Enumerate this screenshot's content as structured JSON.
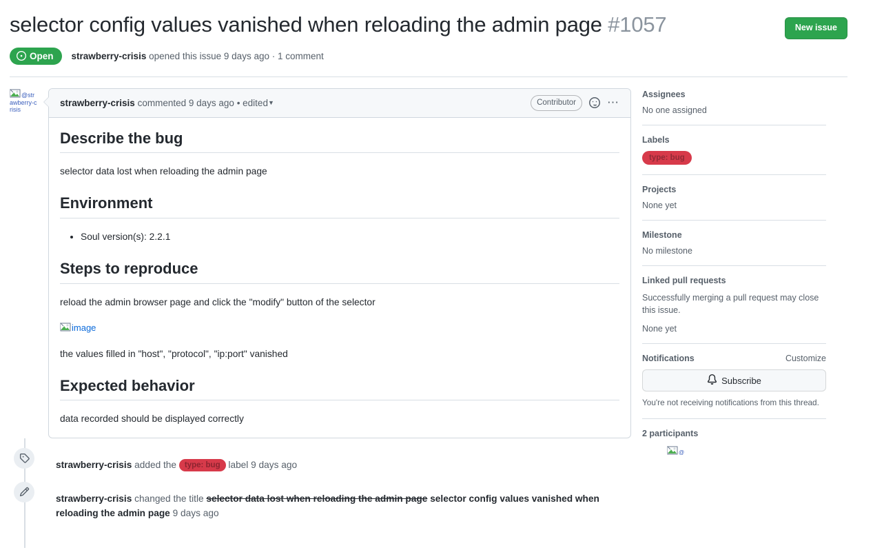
{
  "header": {
    "title": "selector config values vanished when reloading the admin page",
    "issue_number": "#1057",
    "new_issue_label": "New issue",
    "state": "Open",
    "meta_author": "strawberry-crisis",
    "meta_action": "opened this issue 9 days ago",
    "meta_separator": " · ",
    "meta_comments": "1 comment"
  },
  "comment": {
    "avatar_alt": "@strawberry-crisis",
    "author": "strawberry-crisis",
    "commented_text": "commented 9 days ago",
    "edited_text": "• edited",
    "author_badge": "Contributor",
    "reaction_icon": "smiley-icon",
    "menu_icon": "kebab-icon",
    "sections": [
      {
        "heading": "Describe the bug",
        "paragraph": "selector data lost when reloading the admin page"
      },
      {
        "heading": "Environment",
        "bullet": "Soul version(s): 2.2.1"
      },
      {
        "heading": "Steps to reproduce",
        "paragraph": "reload the admin browser page and click the \"modify\" button of the selector",
        "image_alt": "image",
        "paragraph2": "the values filled in \"host\", \"protocol\", \"ip:port\" vanished"
      },
      {
        "heading": "Expected behavior",
        "paragraph": "data recorded should be displayed correctly"
      }
    ]
  },
  "timeline": [
    {
      "icon": "tag-icon",
      "actor": "strawberry-crisis",
      "text_before": "added the",
      "label": "type: bug",
      "text_after": "label 9 days ago"
    },
    {
      "icon": "pencil-icon",
      "actor": "strawberry-crisis",
      "text_before": "changed the title",
      "old_title": "selector data lost when reloading the admin page",
      "new_title": "selector config values vanished when reloading the admin page",
      "text_after": "9 days ago"
    }
  ],
  "sidebar": {
    "assignees": {
      "title": "Assignees",
      "value": "No one assigned"
    },
    "labels": {
      "title": "Labels",
      "chip": "type: bug"
    },
    "projects": {
      "title": "Projects",
      "value": "None yet"
    },
    "milestone": {
      "title": "Milestone",
      "value": "No milestone"
    },
    "linked_prs": {
      "title": "Linked pull requests",
      "note": "Successfully merging a pull request may close this issue.",
      "value": "None yet"
    },
    "notifications": {
      "title": "Notifications",
      "customize": "Customize",
      "subscribe": "Subscribe",
      "bell_icon": "bell-icon",
      "note": "You're not receiving notifications from this thread."
    },
    "participants": {
      "title": "2 participants",
      "avatar_alt": "@p"
    }
  },
  "colors": {
    "green": "#2da44e",
    "label_red": "#d73a4a",
    "link_blue": "#0969da",
    "muted": "#57606a"
  }
}
